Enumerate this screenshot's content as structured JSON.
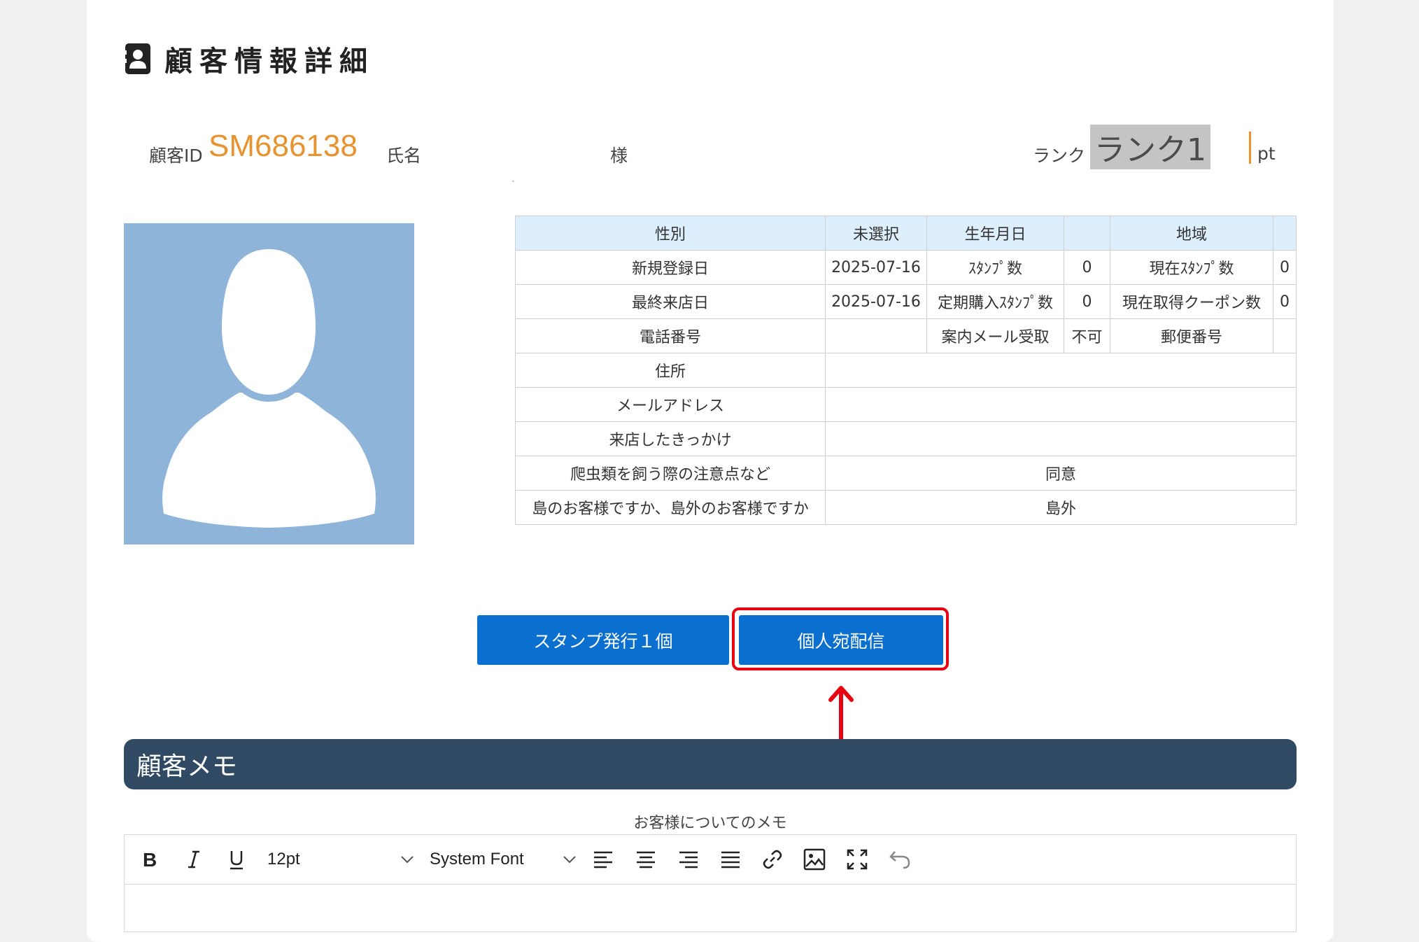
{
  "page": {
    "title": "顧客情報詳細"
  },
  "customer": {
    "id_label": "顧客ID",
    "id_value": "SM686138",
    "name_label": "氏名",
    "honorific": "様",
    "rank_label": "ランク",
    "rank_value": "ランク1",
    "points_unit": "pt"
  },
  "info_table": {
    "header": {
      "gender_label": "性別",
      "gender_value": "未選択",
      "birthday_label": "生年月日",
      "birthday_value": "",
      "region_label": "地域",
      "region_value": ""
    },
    "rows": [
      {
        "l1": "新規登録日",
        "v1": "2025-07-16",
        "l2": "ｽﾀﾝﾌﾟ数",
        "v2": "0",
        "l3": "現在ｽﾀﾝﾌﾟ数",
        "v3": "0"
      },
      {
        "l1": "最終来店日",
        "v1": "2025-07-16",
        "l2": "定期購入ｽﾀﾝﾌﾟ数",
        "v2": "0",
        "l3": "現在取得クーポン数",
        "v3": "0"
      },
      {
        "l1": "電話番号",
        "v1": "",
        "l2": "案内メール受取",
        "v2": "不可",
        "l3": "郵便番号",
        "v3": ""
      }
    ],
    "wide_rows": [
      {
        "label": "住所",
        "value": ""
      },
      {
        "label": "メールアドレス",
        "value": ""
      },
      {
        "label": "来店したきっかけ",
        "value": ""
      },
      {
        "label": "爬虫類を飼う際の注意点など",
        "value": "同意"
      },
      {
        "label": "島のお客様ですか、島外のお客様ですか",
        "value": "島外"
      }
    ]
  },
  "actions": {
    "stamp_button": "スタンプ発行１個",
    "deliver_button": "個人宛配信"
  },
  "memo": {
    "section_title": "顧客メモ",
    "subtitle": "お客様についてのメモ",
    "font_size": "12pt",
    "font_family": "System Font"
  },
  "colors": {
    "accent": "#e69330",
    "primary": "#0a6fcf",
    "highlight": "#e60012",
    "header_bar": "#304a64",
    "avatar_bg": "#8fb4d9"
  }
}
